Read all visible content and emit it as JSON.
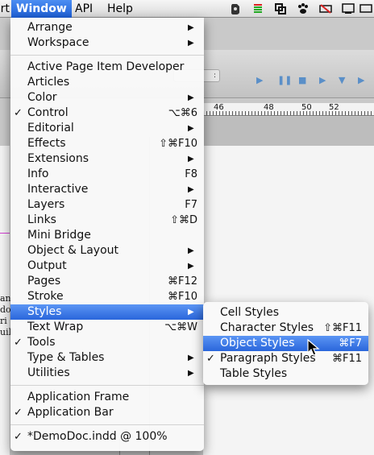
{
  "menubar": {
    "items": [
      {
        "label": "ort"
      },
      {
        "label": "Window"
      },
      {
        "label": "API"
      },
      {
        "label": "Help"
      }
    ],
    "tray_icons": [
      "evernote-icon",
      "volume-bars-icon",
      "sync-icon",
      "paw-icon",
      "network-disabled-icon",
      "wifi-icon",
      "display-icon"
    ]
  },
  "background": {
    "ruler_numbers": [
      "46",
      "48",
      "50",
      "52"
    ],
    "field_value": ":",
    "left_texts": [
      "an",
      "do",
      "ri",
      "uil"
    ]
  },
  "menu": {
    "groups": [
      [
        {
          "label": "Arrange",
          "submenu": true
        },
        {
          "label": "Workspace",
          "submenu": true
        }
      ],
      [
        {
          "label": "Active Page Item Developer"
        },
        {
          "label": "Articles"
        },
        {
          "label": "Color",
          "submenu": true
        },
        {
          "label": "Control",
          "checked": true,
          "shortcut": "⌥⌘6"
        },
        {
          "label": "Editorial",
          "submenu": true
        },
        {
          "label": "Effects",
          "shortcut": "⇧⌘F10"
        },
        {
          "label": "Extensions",
          "submenu": true
        },
        {
          "label": "Info",
          "shortcut": "F8"
        },
        {
          "label": "Interactive",
          "submenu": true
        },
        {
          "label": "Layers",
          "shortcut": "F7"
        },
        {
          "label": "Links",
          "shortcut": "⇧⌘D"
        },
        {
          "label": "Mini Bridge"
        },
        {
          "label": "Object & Layout",
          "submenu": true
        },
        {
          "label": "Output",
          "submenu": true
        },
        {
          "label": "Pages",
          "shortcut": "⌘F12"
        },
        {
          "label": "Stroke",
          "shortcut": "⌘F10"
        },
        {
          "label": "Styles",
          "submenu": true,
          "highlighted": true
        },
        {
          "label": "Text Wrap",
          "shortcut": "⌥⌘W"
        },
        {
          "label": "Tools",
          "checked": true
        },
        {
          "label": "Type & Tables",
          "submenu": true
        },
        {
          "label": "Utilities",
          "submenu": true
        }
      ],
      [
        {
          "label": "Application Frame"
        },
        {
          "label": "Application Bar",
          "checked": true
        }
      ],
      [
        {
          "label": "*DemoDoc.indd @ 100%",
          "checked": true
        }
      ]
    ]
  },
  "submenu": {
    "items": [
      {
        "label": "Cell Styles"
      },
      {
        "label": "Character Styles",
        "shortcut": "⇧⌘F11"
      },
      {
        "label": "Object Styles",
        "shortcut": "⌘F7",
        "highlighted": true
      },
      {
        "label": "Paragraph Styles",
        "shortcut": "⌘F11",
        "checked": true
      },
      {
        "label": "Table Styles"
      }
    ]
  }
}
